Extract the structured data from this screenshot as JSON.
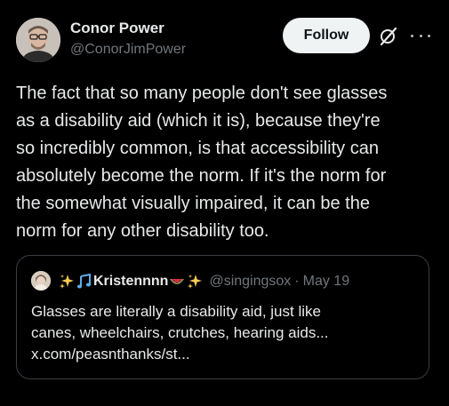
{
  "author": {
    "name": "Conor Power",
    "handle": "@ConorJimPower",
    "avatar_icon": "person-avatar"
  },
  "actions": {
    "follow_label": "Follow",
    "grok_icon": "grok-icon",
    "more_icon": "more-icon"
  },
  "post": {
    "lines": [
      "The fact that so many people don't see glasses",
      "as a disability aid (which it is), because they're",
      "so incredibly common, is that accessibility can",
      "absolutely become the norm. If it's the norm for",
      "the somewhat visually impaired, it can be the",
      "norm for any other disability too."
    ]
  },
  "quote": {
    "name": "Kristennnn",
    "name_prefix_emojis": [
      "sparkles-emoji",
      "music-notes-emoji"
    ],
    "name_suffix_emojis": [
      "watermelon-emoji",
      "sparkles-emoji"
    ],
    "handle": "@singingsox",
    "separator": "·",
    "date": "May 19",
    "lines": [
      "Glasses are literally a disability aid, just like",
      "canes, wheelchairs, crutches, hearing aids...",
      "x.com/peasnthanks/st..."
    ]
  },
  "colors": {
    "background": "#000000",
    "text": "#e7e9ea",
    "secondary_text": "#71767b",
    "follow_button_bg": "#eff3f4",
    "follow_button_text": "#0f1419",
    "quote_border": "#3a3e43"
  }
}
